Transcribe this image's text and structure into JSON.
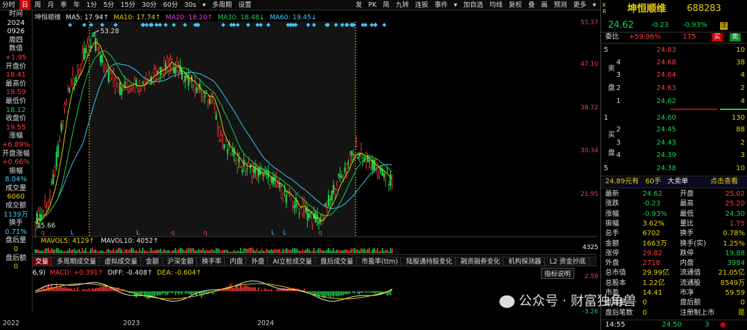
{
  "toolbar": {
    "left_items": [
      "分时",
      "日",
      "周",
      "月",
      "季",
      "年",
      "1分",
      "5分",
      "15分",
      "30分",
      "60分",
      "30s",
      "▾",
      "多周期",
      "设置"
    ],
    "right_items": [
      "发",
      "PK",
      "简",
      "九转",
      "连扳",
      "事件",
      "▾",
      "加自选",
      "均线",
      "复权",
      "叠",
      "画",
      "预测",
      "更多",
      "▾"
    ],
    "selected": "日"
  },
  "left_panel": [
    {
      "k": "时间",
      "v": "2024"
    },
    {
      "k": "",
      "v": "0926"
    },
    {
      "k": "",
      "v": "周四"
    },
    {
      "k": "数值",
      "v": "+1.95"
    },
    {
      "k": "开盘价",
      "v": "18.41"
    },
    {
      "k": "最高价",
      "v": "19.59"
    },
    {
      "k": "最低价",
      "v": "18.12"
    },
    {
      "k": "收盘价",
      "v": "19.55"
    },
    {
      "k": "涨幅",
      "v": "+6.89%"
    },
    {
      "k": "开盘涨幅",
      "v": "+0.66%"
    },
    {
      "k": "振幅",
      "v": "8.04%"
    },
    {
      "k": "成交量",
      "v": "6060"
    },
    {
      "k": "成交额",
      "v": "1139万"
    },
    {
      "k": "换手",
      "v": "0.71%"
    },
    {
      "k": "盘后量",
      "v": "0"
    },
    {
      "k": "盘后额",
      "v": "0"
    }
  ],
  "ma_legend": [
    {
      "label": "坤恒顺维",
      "color": "#dddddd"
    },
    {
      "label": "MA5: 17.94↑",
      "color": "#eeeeee"
    },
    {
      "label": "MA10: 17.74↑",
      "color": "#e8d200"
    },
    {
      "label": "MA20: 18.20↑",
      "color": "#e040e0"
    },
    {
      "label": "MA30: 18.48↓",
      "color": "#19d34c"
    },
    {
      "label": "MA60: 19.45↓",
      "color": "#3cc8ff"
    }
  ],
  "price_axis": [
    "55.37",
    "47.10",
    "38.72",
    "30.34",
    "21.95"
  ],
  "price_annotations": {
    "high": "53.28",
    "low": "15.66"
  },
  "volume_legend": [
    "MAVOL5: 4129↑",
    "MAVOL10: 4052↑"
  ],
  "volume_axis": "4325",
  "indicator_tabs": [
    "交量",
    "多周期成交量",
    "虚拟成交量",
    "金额",
    "沪深金额",
    "换手率",
    "内盘",
    "外盘",
    "AI立桩成交量",
    "盘后成交量",
    "市盈率(ttm)",
    "陆股通持股变化",
    "融资融券变化",
    "机构探测器",
    "L2 资金抄底"
  ],
  "indicator_selected": "交量",
  "macd_legend": [
    "6,9)",
    "MACD: +0.391↑",
    "DIFF: -0.408↑",
    "DEA: -0.604↑"
  ],
  "macd_axis": [
    "2.59",
    "-3.26"
  ],
  "indicator_help": "指标说明",
  "x_axis": [
    "2022",
    "2023",
    "2024"
  ],
  "stock": {
    "name": "坤恒顺维",
    "code": "688283",
    "price": "24.62",
    "change": "-0.23",
    "pct": "-0.93%",
    "tag": "注"
  },
  "weibi": {
    "label": "委比",
    "value": "+59.96%",
    "diff": "175",
    "buy": "买",
    "sell": "卖"
  },
  "asks": [
    {
      "lvl": "5",
      "price": "24.83",
      "vol": "10"
    },
    {
      "lvl": "4",
      "price": "24.68",
      "vol": "38"
    },
    {
      "lvl": "3",
      "price": "24.64",
      "vol": "4"
    },
    {
      "lvl": "2",
      "price": "24.63",
      "vol": "2"
    },
    {
      "lvl": "1",
      "price": "24.62",
      "vol": "4"
    }
  ],
  "ask_label": [
    "卖",
    "盘"
  ],
  "bids": [
    {
      "lvl": "1",
      "price": "24.60",
      "vol": "130"
    },
    {
      "lvl": "2",
      "price": "24.45",
      "vol": "88"
    },
    {
      "lvl": "3",
      "price": "24.43",
      "vol": "2"
    },
    {
      "lvl": "4",
      "price": "24.39",
      "vol": "3"
    },
    {
      "lvl": "5",
      "price": "24.38",
      "vol": "10"
    }
  ],
  "bid_label": [
    "买",
    "盘"
  ],
  "bigorder": {
    "amount": "24.89元有",
    "hands": "60手",
    "title": "大卖单",
    "link": "点击查看"
  },
  "quote": [
    [
      "最新",
      "24.62",
      "开盘",
      "25.02"
    ],
    [
      "涨跌",
      "-0.23",
      "最高",
      "25.20"
    ],
    [
      "涨幅",
      "-0.93%",
      "最低",
      "24.30"
    ],
    [
      "振幅",
      "3.62%",
      "量比",
      "1.75"
    ],
    [
      "总手",
      "6702",
      "换手",
      "0.78%"
    ],
    [
      "金额",
      "1663万",
      "换手(实)",
      "1.25%"
    ],
    [
      "涨停",
      "29.82",
      "跌停",
      "19.88"
    ],
    [
      "外盘",
      "2718",
      "内盘",
      "3984"
    ],
    [
      "总市值",
      "29.99亿",
      "流通值",
      "21.05亿"
    ],
    [
      "总股本",
      "1.22亿",
      "流通股",
      "8549万"
    ],
    [
      "市盈",
      "14.41",
      "市净",
      "59.59"
    ],
    [
      "盘后量",
      "0",
      "盘后额",
      "0"
    ],
    [
      "盘后笔数",
      "0",
      "注册制上市",
      "是"
    ]
  ],
  "tick": {
    "time": "14:55",
    "price": "24.50",
    "vol": "3"
  },
  "watermark": "公众号 · 财富独角兽",
  "colors": {
    "up": "#ff3b3b",
    "down": "#19d34c",
    "accent": "#c00000",
    "bg": "#000000"
  }
}
